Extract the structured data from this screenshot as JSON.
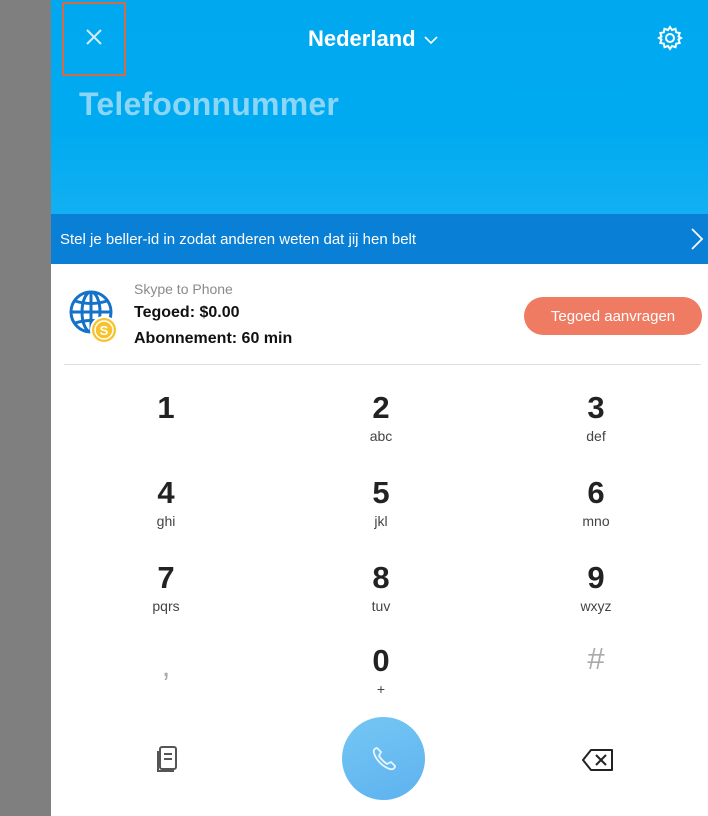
{
  "header": {
    "country": "Nederland",
    "phone_placeholder": "Telefoonnummer"
  },
  "caller_id_banner": {
    "text": "Stel je beller-id in zodat anderen weten dat jij hen belt"
  },
  "credit": {
    "product": "Skype to Phone",
    "balance": "Tegoed: $0.00",
    "subscription": "Abonnement: 60 min",
    "button": "Tegoed aanvragen"
  },
  "keypad": [
    {
      "digit": "1",
      "letters": ""
    },
    {
      "digit": "2",
      "letters": "abc"
    },
    {
      "digit": "3",
      "letters": "def"
    },
    {
      "digit": "4",
      "letters": "ghi"
    },
    {
      "digit": "5",
      "letters": "jkl"
    },
    {
      "digit": "6",
      "letters": "mno"
    },
    {
      "digit": "7",
      "letters": "pqrs"
    },
    {
      "digit": "8",
      "letters": "tuv"
    },
    {
      "digit": "9",
      "letters": "wxyz"
    },
    {
      "digit": ",",
      "letters": ""
    },
    {
      "digit": "0",
      "letters": "+"
    },
    {
      "digit": "#",
      "letters": ""
    }
  ],
  "icons": {
    "close": "close-icon",
    "chevron": "chevron-down-icon",
    "settings": "gear-icon",
    "banner_arrow": "chevron-right-icon",
    "globe": "globe-coin-icon",
    "contacts": "contacts-icon",
    "call": "phone-icon",
    "backspace": "backspace-icon"
  },
  "colors": {
    "header_bg": "#00a8f0",
    "banner_bg": "#0a7fd6",
    "credit_button": "#ef7b63",
    "call_button": "#6bbcf1",
    "highlight_border": "#d36a48"
  }
}
